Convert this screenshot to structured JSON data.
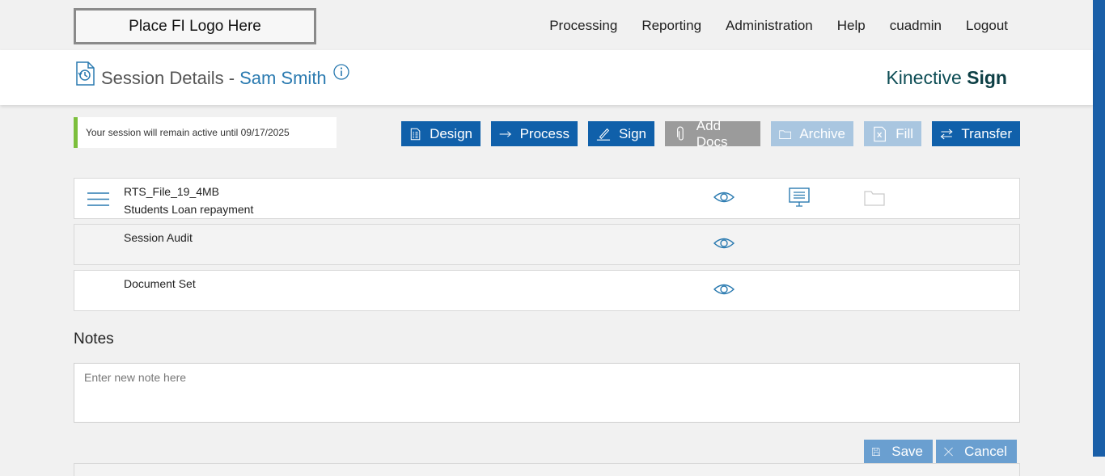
{
  "logo": {
    "text": "Place FI Logo Here"
  },
  "nav": {
    "items": [
      "Processing",
      "Reporting",
      "Administration",
      "Help",
      "cuadmin",
      "Logout"
    ]
  },
  "header": {
    "title": "Session Details -",
    "name": "Sam Smith",
    "brand_light": "Kinective",
    "brand_bold": "Sign"
  },
  "status": {
    "text": "Your session will remain active until 09/17/2025"
  },
  "actions": {
    "design": "Design",
    "process": "Process",
    "sign": "Sign",
    "add_docs": "Add Docs",
    "archive": "Archive",
    "fill": "Fill",
    "transfer": "Transfer"
  },
  "documents": [
    {
      "title": "RTS_File_19_4MB",
      "subtitle": "Students Loan repayment"
    },
    {
      "title": "Session Audit"
    },
    {
      "title": "Document Set"
    }
  ],
  "notes": {
    "label": "Notes",
    "placeholder": "Enter new note here",
    "save": "Save",
    "cancel": "Cancel"
  },
  "colors": {
    "primary": "#1060aa",
    "accent_green": "#7cbf3c",
    "link_blue": "#2a7ab0",
    "disabled_gray": "#9b9b9b",
    "disabled_light": "#a9c6e0"
  }
}
